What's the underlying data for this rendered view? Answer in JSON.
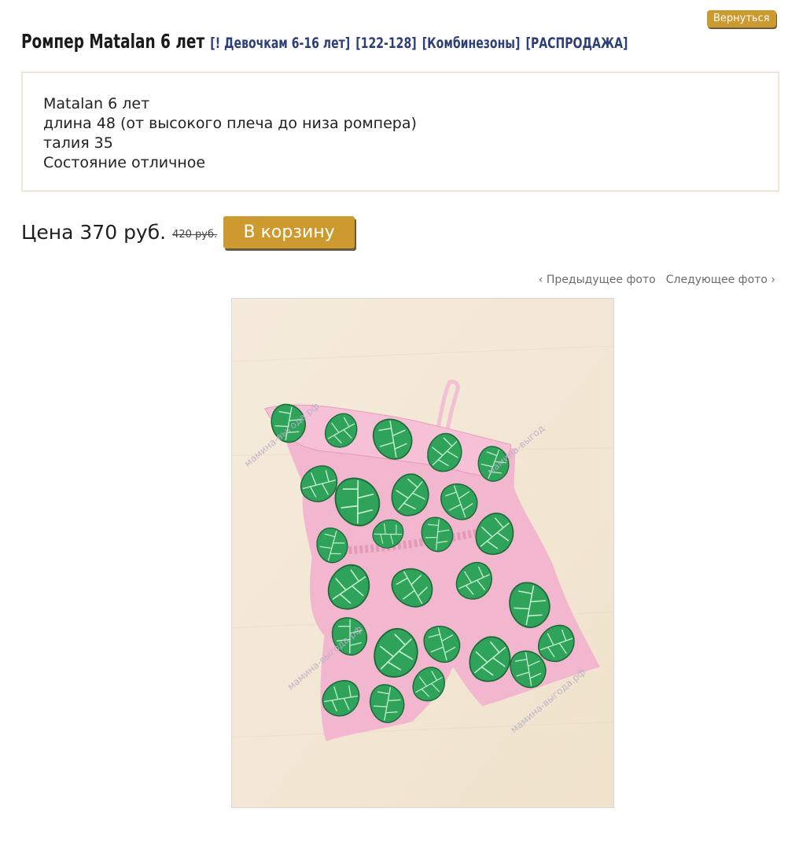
{
  "header": {
    "back_label": "Вернуться",
    "product_title": "Ромпер Matalan 6 лет",
    "categories": [
      "[! Девочкам 6-16 лет]",
      "[122-128]",
      "[Комбинезоны]",
      "[РАСПРОДАЖА]"
    ]
  },
  "description": {
    "lines": [
      "Matalan 6 лет",
      "длина 48 (от высокого плеча до низа ромпера)",
      "талия 35",
      "Состояние отличное"
    ]
  },
  "price": {
    "label": "Цена 370 руб.",
    "old_price": "420 руб.",
    "cart_button_label": "В корзину"
  },
  "photo_nav": {
    "prev_label": "‹ Предыдущее фото",
    "next_label": "Следующее фото ›"
  },
  "photo": {
    "subject": "pink romper with green monstera leaf print",
    "watermark": "мамина-выгода.рф"
  },
  "colors": {
    "accent": "#cc9a2e",
    "category_link": "#2d3f79",
    "box_border": "#ece6d2"
  }
}
